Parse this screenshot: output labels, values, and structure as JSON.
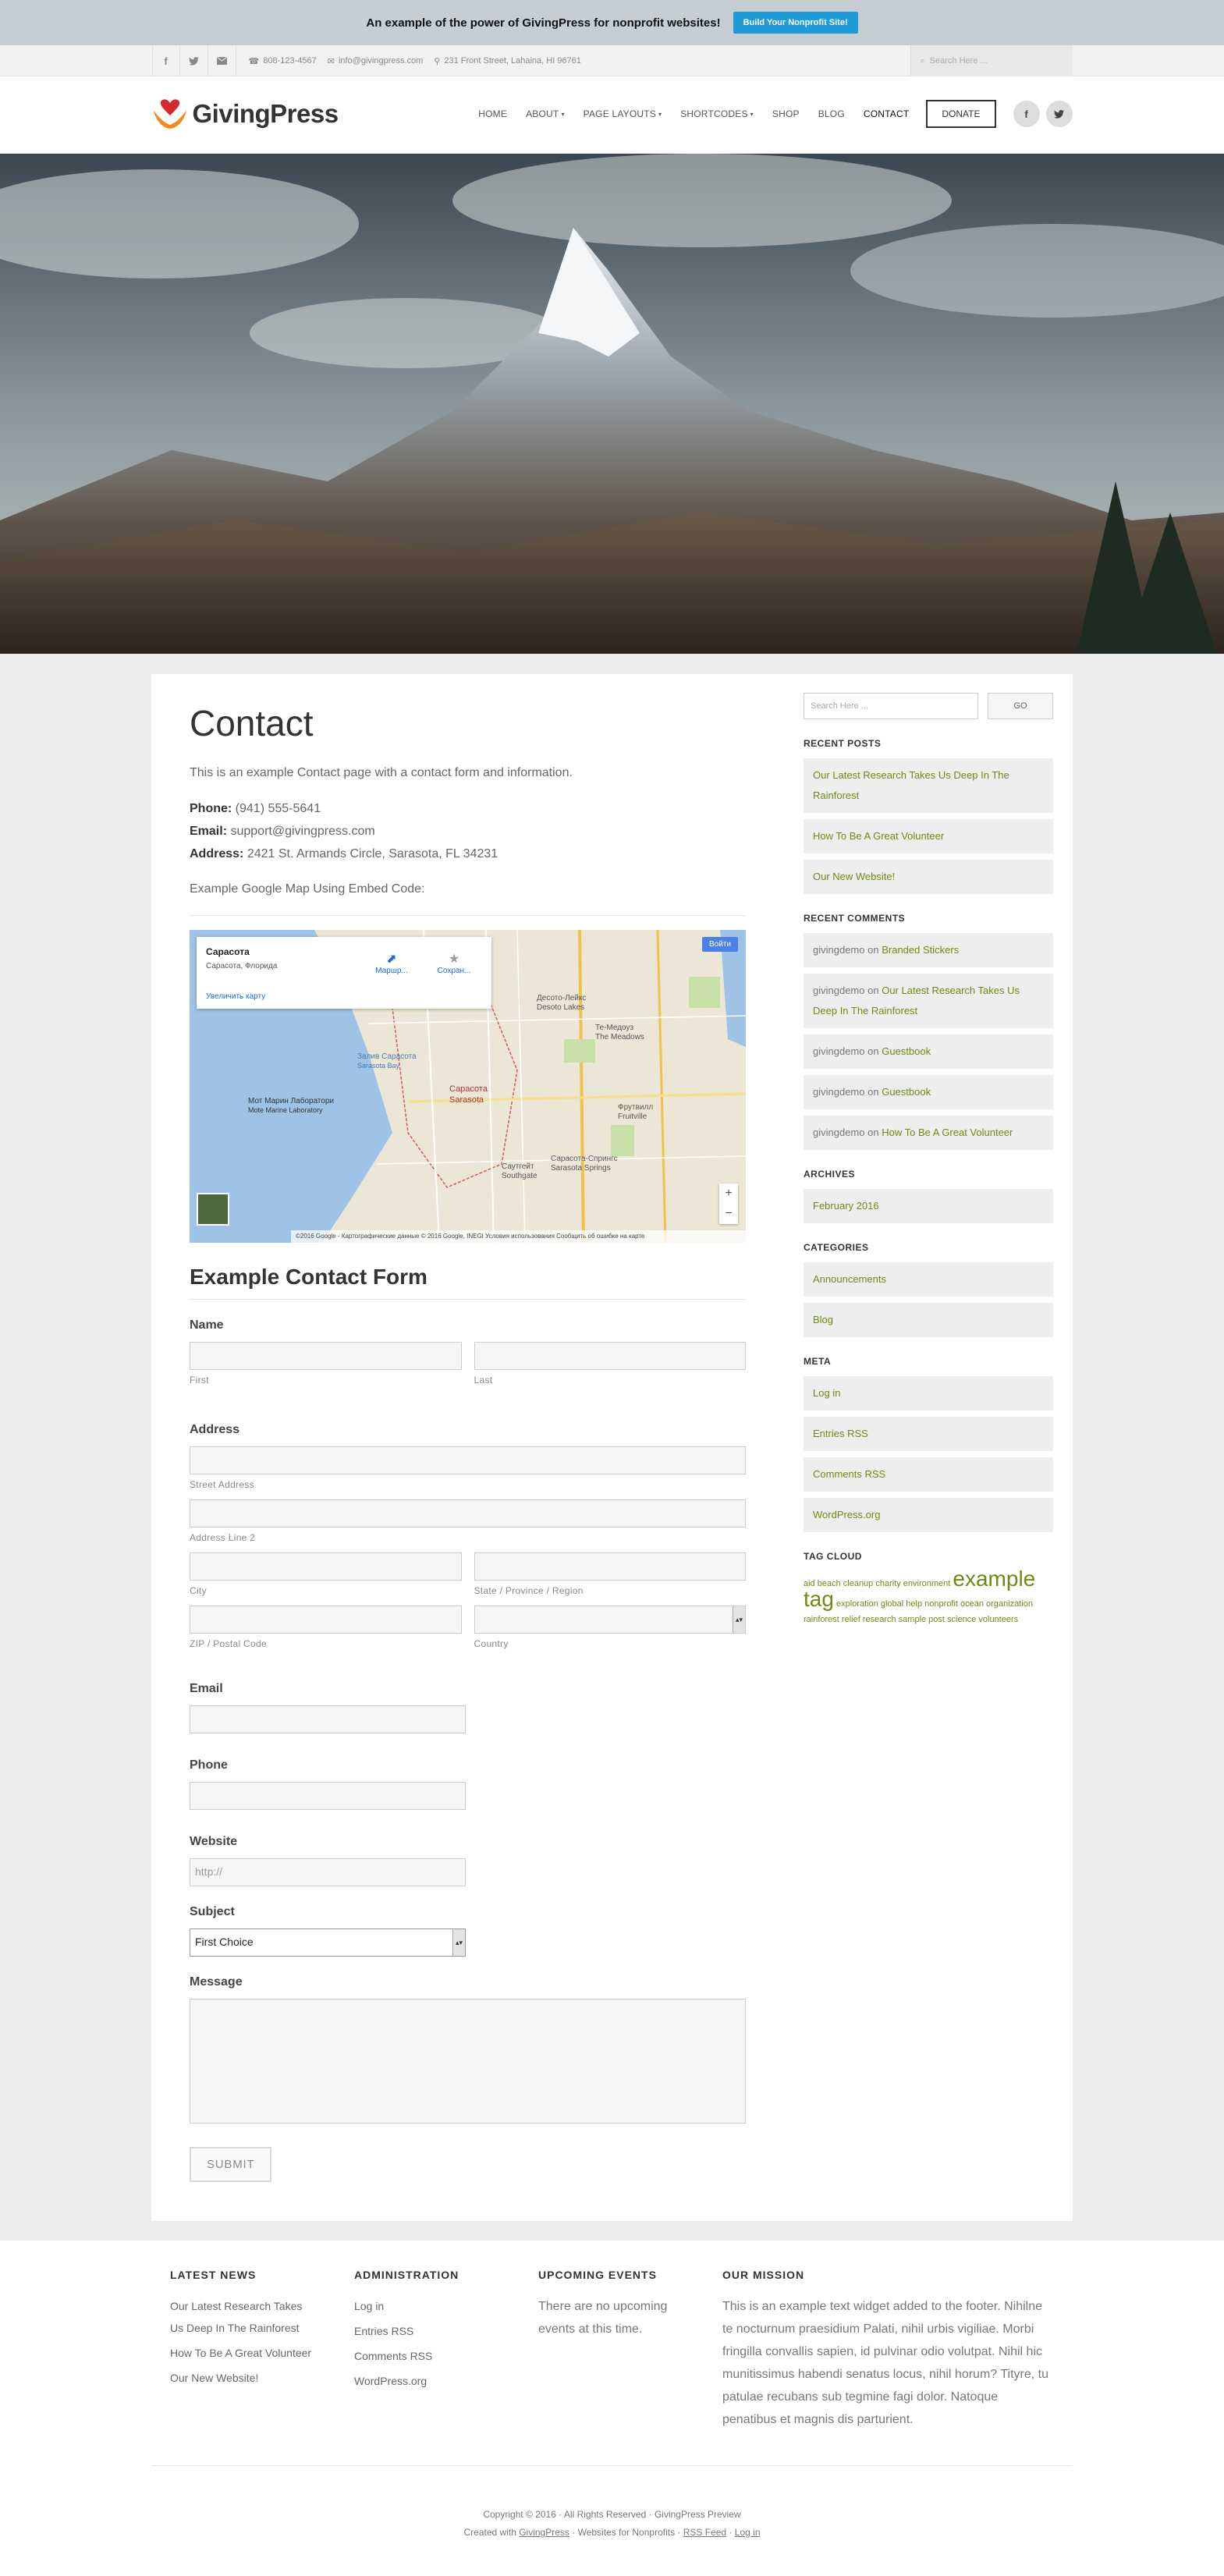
{
  "promo": {
    "text": "An example of the power of GivingPress for nonprofit websites!",
    "button": "Build Your Nonprofit Site!"
  },
  "topbar": {
    "phone": "808-123-4567",
    "email": "info@givingpress.com",
    "address": "231 Front Street, Lahaina, HI 96761",
    "search_placeholder": "Search Here ..."
  },
  "header": {
    "logo": "GivingPress",
    "nav": [
      "HOME",
      "ABOUT",
      "PAGE LAYOUTS",
      "SHORTCODES",
      "SHOP",
      "BLOG",
      "CONTACT"
    ],
    "donate": "DONATE"
  },
  "page": {
    "title": "Contact",
    "intro": "This is an example Contact page with a contact form and information.",
    "phone_label": "Phone:",
    "phone": "(941) 555-5641",
    "email_label": "Email:",
    "email": "support@givingpress.com",
    "address_label": "Address:",
    "address": "2421 St. Armands Circle, Sarasota, FL 34231",
    "embed_note": "Example Google Map Using Embed Code:"
  },
  "map": {
    "place": "Сарасота",
    "place_sub": "Сарасота, Флорида",
    "enlarge": "Увеличить карту",
    "route": "Маршр...",
    "save": "Сохран...",
    "login": "Войти",
    "footer": "©2016 Google - Картографические данные © 2016 Google, INEGI   Условия использования   Сообщить об ошибке на карте",
    "labels": [
      "Сарасота",
      "Sarasota",
      "Сарасота-Спрингс",
      "Sarasota Springs",
      "Саутгейт",
      "Southgate",
      "Фрутвилл",
      "Fruitville",
      "Мот Марин Лаборатори",
      "Mote Marine Laboratory",
      "Залив Сарасота",
      "Sarasota Bay",
      "Десото-Лейкс",
      "Desoto Lakes",
      "Те-Медоуз",
      "The Meadows"
    ]
  },
  "form": {
    "title": "Example Contact Form",
    "name": "Name",
    "first": "First",
    "last": "Last",
    "address": "Address",
    "street": "Street Address",
    "line2": "Address Line 2",
    "city": "City",
    "state": "State / Province / Region",
    "zip": "ZIP / Postal Code",
    "country": "Country",
    "email": "Email",
    "phone": "Phone",
    "website": "Website",
    "website_placeholder": "http://",
    "subject": "Subject",
    "subject_value": "First Choice",
    "message": "Message",
    "submit": "SUBMIT"
  },
  "sidebar": {
    "search_placeholder": "Search Here ...",
    "go": "GO",
    "recent_posts_title": "RECENT POSTS",
    "recent_posts": [
      "Our Latest Research Takes Us Deep In The Rainforest",
      "How To Be A Great Volunteer",
      "Our New Website!"
    ],
    "recent_comments_title": "RECENT COMMENTS",
    "comments": [
      {
        "user": "givingdemo",
        "on": "on",
        "post": "Branded Stickers"
      },
      {
        "user": "givingdemo",
        "on": "on",
        "post": "Our Latest Research Takes Us Deep In The Rainforest"
      },
      {
        "user": "givingdemo",
        "on": "on",
        "post": "Guestbook"
      },
      {
        "user": "givingdemo",
        "on": "on",
        "post": "Guestbook"
      },
      {
        "user": "givingdemo",
        "on": "on",
        "post": "How To Be A Great Volunteer"
      }
    ],
    "archives_title": "ARCHIVES",
    "archives": [
      "February 2016"
    ],
    "categories_title": "CATEGORIES",
    "categories": [
      "Announcements",
      "Blog"
    ],
    "meta_title": "META",
    "meta": [
      "Log in",
      "Entries RSS",
      "Comments RSS",
      "WordPress.org"
    ],
    "tag_cloud_title": "TAG CLOUD",
    "tags_a": "aid beach cleanup charity environment",
    "tags_big1": "example",
    "tags_big2": "tag",
    "tags_b": "exploration global help nonprofit ocean organization rainforest relief research sample post science volunteers"
  },
  "footer": {
    "news_title": "LATEST NEWS",
    "news": [
      "Our Latest Research Takes Us Deep In The Rainforest",
      "How To Be A Great Volunteer",
      "Our New Website!"
    ],
    "admin_title": "ADMINISTRATION",
    "admin": [
      "Log in",
      "Entries RSS",
      "Comments RSS",
      "WordPress.org"
    ],
    "events_title": "UPCOMING EVENTS",
    "events_text": "There are no upcoming events at this time.",
    "mission_title": "OUR MISSION",
    "mission_text": "This is an example text widget added to the footer. Nihilne te nocturnum praesidium Palati, nihil urbis vigiliae. Morbi fringilla convallis sapien, id pulvinar odio volutpat. Nihil hic munitissimus habendi senatus locus, nihil horum? Tityre, tu patulae recubans sub tegmine fagi dolor. Natoque penatibus et magnis dis parturient.",
    "copyright": "Copyright © 2016 · All Rights Reserved · GivingPress Preview",
    "created_pre": "Created with",
    "created_link": "GivingPress",
    "created_mid": "· Websites for Nonprofits ·",
    "rss": "RSS Feed",
    "sep": "·",
    "login": "Log in"
  },
  "colors": {
    "accent": "#6c8b13",
    "promo_button": "#1e9bd8"
  }
}
